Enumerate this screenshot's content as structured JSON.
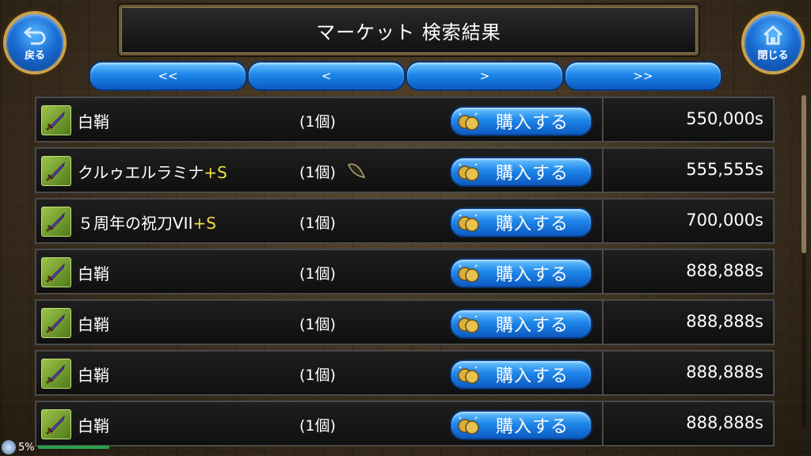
{
  "header": {
    "title": "マーケット 検索結果",
    "back_label": "戻る",
    "close_label": "閉じる"
  },
  "nav": {
    "first": "<<",
    "prev": "<",
    "next": ">",
    "last": ">>"
  },
  "buy_label": "購入する",
  "items": [
    {
      "name": "白鞘",
      "plus": "",
      "qty": "(1個)",
      "price": "550,000s",
      "leaf": false
    },
    {
      "name": "クルゥエルラミナ",
      "plus": "+S",
      "qty": "(1個)",
      "price": "555,555s",
      "leaf": true
    },
    {
      "name": "５周年の祝刀VII",
      "plus": "+S",
      "qty": "(1個)",
      "price": "700,000s",
      "leaf": false
    },
    {
      "name": "白鞘",
      "plus": "",
      "qty": "(1個)",
      "price": "888,888s",
      "leaf": false
    },
    {
      "name": "白鞘",
      "plus": "",
      "qty": "(1個)",
      "price": "888,888s",
      "leaf": false
    },
    {
      "name": "白鞘",
      "plus": "",
      "qty": "(1個)",
      "price": "888,888s",
      "leaf": false
    },
    {
      "name": "白鞘",
      "plus": "",
      "qty": "(1個)",
      "price": "888,888s",
      "leaf": false
    }
  ],
  "status": {
    "percent": "5%"
  },
  "colors": {
    "accent_blue": "#1e86ea",
    "plus_yellow": "#f0e040",
    "frame_gold": "#c9a24e"
  }
}
